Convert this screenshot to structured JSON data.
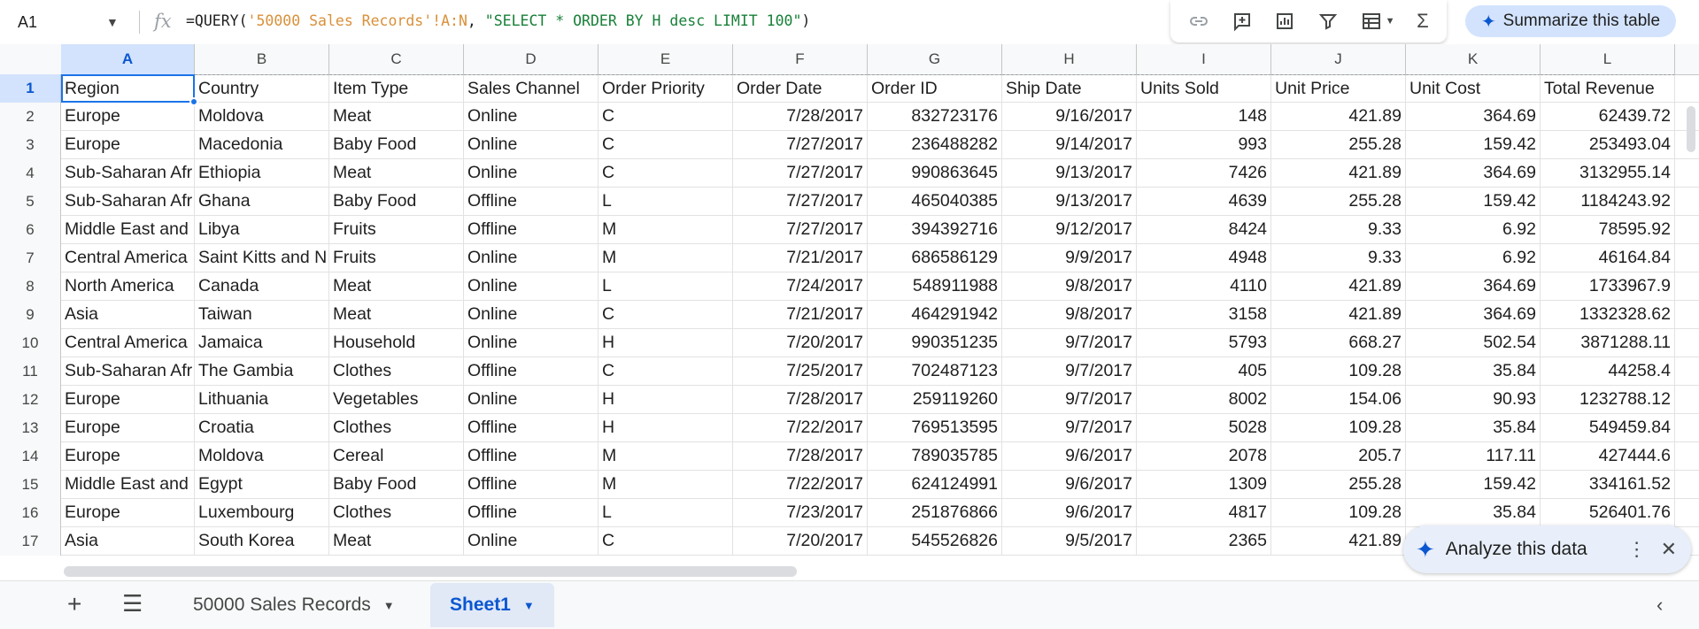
{
  "formula_bar": {
    "name_box": "A1",
    "fx": "fx",
    "formula_prefix": "=QUERY(",
    "formula_range": "'50000 Sales Records'!A:N",
    "formula_sep": ", ",
    "formula_query": "\"SELECT * ORDER BY H desc LIMIT 100\"",
    "formula_suffix": ")"
  },
  "toolbox": {
    "icons": [
      "link-icon",
      "add-comment-icon",
      "chart-icon",
      "filter-icon",
      "table-icon",
      "sigma-icon"
    ]
  },
  "summarize_button": "Summarize this table",
  "analyze_chip": "Analyze this data",
  "columns": [
    "A",
    "B",
    "C",
    "D",
    "E",
    "F",
    "G",
    "H",
    "I",
    "J",
    "K",
    "L"
  ],
  "row_numbers": [
    "1",
    "2",
    "3",
    "4",
    "5",
    "6",
    "7",
    "8",
    "9",
    "10",
    "11",
    "12",
    "13",
    "14",
    "15",
    "16",
    "17"
  ],
  "rows": [
    [
      "Region",
      "Country",
      "Item Type",
      "Sales Channel",
      "Order Priority",
      "Order Date",
      "Order ID",
      "Ship Date",
      "Units Sold",
      "Unit Price",
      "Unit Cost",
      "Total Revenue"
    ],
    [
      "Europe",
      "Moldova",
      "Meat",
      "Online",
      "C",
      "7/28/2017",
      "832723176",
      "9/16/2017",
      "148",
      "421.89",
      "364.69",
      "62439.72"
    ],
    [
      "Europe",
      "Macedonia",
      "Baby Food",
      "Online",
      "C",
      "7/27/2017",
      "236488282",
      "9/14/2017",
      "993",
      "255.28",
      "159.42",
      "253493.04"
    ],
    [
      "Sub-Saharan Afr",
      "Ethiopia",
      "Meat",
      "Online",
      "C",
      "7/27/2017",
      "990863645",
      "9/13/2017",
      "7426",
      "421.89",
      "364.69",
      "3132955.14"
    ],
    [
      "Sub-Saharan Afr",
      "Ghana",
      "Baby Food",
      "Offline",
      "L",
      "7/27/2017",
      "465040385",
      "9/13/2017",
      "4639",
      "255.28",
      "159.42",
      "1184243.92"
    ],
    [
      "Middle East and",
      "Libya",
      "Fruits",
      "Offline",
      "M",
      "7/27/2017",
      "394392716",
      "9/12/2017",
      "8424",
      "9.33",
      "6.92",
      "78595.92"
    ],
    [
      "Central America",
      "Saint Kitts and N",
      "Fruits",
      "Online",
      "M",
      "7/21/2017",
      "686586129",
      "9/9/2017",
      "4948",
      "9.33",
      "6.92",
      "46164.84"
    ],
    [
      "North America",
      "Canada",
      "Meat",
      "Online",
      "L",
      "7/24/2017",
      "548911988",
      "9/8/2017",
      "4110",
      "421.89",
      "364.69",
      "1733967.9"
    ],
    [
      "Asia",
      "Taiwan",
      "Meat",
      "Online",
      "C",
      "7/21/2017",
      "464291942",
      "9/8/2017",
      "3158",
      "421.89",
      "364.69",
      "1332328.62"
    ],
    [
      "Central America",
      "Jamaica",
      "Household",
      "Online",
      "H",
      "7/20/2017",
      "990351235",
      "9/7/2017",
      "5793",
      "668.27",
      "502.54",
      "3871288.11"
    ],
    [
      "Sub-Saharan Afr",
      "The Gambia",
      "Clothes",
      "Offline",
      "C",
      "7/25/2017",
      "702487123",
      "9/7/2017",
      "405",
      "109.28",
      "35.84",
      "44258.4"
    ],
    [
      "Europe",
      "Lithuania",
      "Vegetables",
      "Online",
      "H",
      "7/28/2017",
      "259119260",
      "9/7/2017",
      "8002",
      "154.06",
      "90.93",
      "1232788.12"
    ],
    [
      "Europe",
      "Croatia",
      "Clothes",
      "Offline",
      "H",
      "7/22/2017",
      "769513595",
      "9/7/2017",
      "5028",
      "109.28",
      "35.84",
      "549459.84"
    ],
    [
      "Europe",
      "Moldova",
      "Cereal",
      "Offline",
      "M",
      "7/28/2017",
      "789035785",
      "9/6/2017",
      "2078",
      "205.7",
      "117.11",
      "427444.6"
    ],
    [
      "Middle East and",
      "Egypt",
      "Baby Food",
      "Offline",
      "M",
      "7/22/2017",
      "624124991",
      "9/6/2017",
      "1309",
      "255.28",
      "159.42",
      "334161.52"
    ],
    [
      "Europe",
      "Luxembourg",
      "Clothes",
      "Offline",
      "L",
      "7/23/2017",
      "251876866",
      "9/6/2017",
      "4817",
      "109.28",
      "35.84",
      "526401.76"
    ],
    [
      "Asia",
      "South Korea",
      "Meat",
      "Online",
      "C",
      "7/20/2017",
      "545526826",
      "9/5/2017",
      "2365",
      "421.89",
      "",
      ""
    ]
  ],
  "sheet_tabs": [
    {
      "label": "50000 Sales Records",
      "active": false
    },
    {
      "label": "Sheet1",
      "active": true
    }
  ]
}
